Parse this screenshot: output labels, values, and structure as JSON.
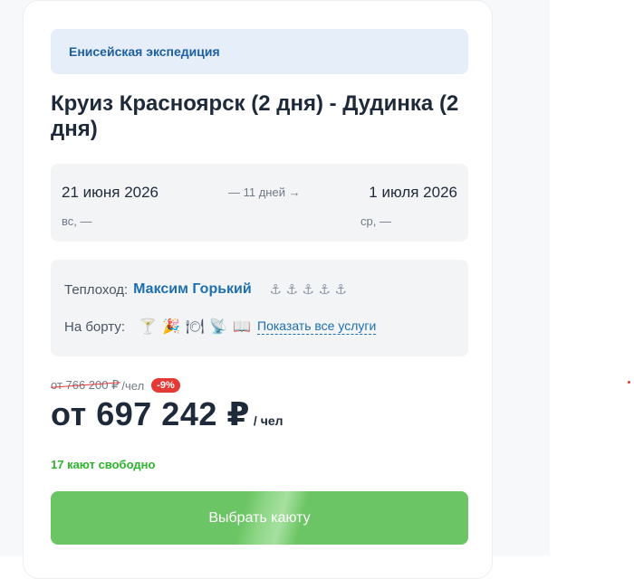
{
  "card": {
    "operator": "Енисейская экспедиция",
    "title": "Круиз Красноярск (2 дня) - Дудинка (2 дня)",
    "dates": {
      "start_date": "21 июня 2026",
      "start_day": "вс, —",
      "duration": "— 11 дней →",
      "end_date": "1 июля 2026",
      "end_day": "ср, —"
    },
    "ship": {
      "label": "Теплоход:",
      "name": "Максим Горький",
      "anchor_glyph": "⚓",
      "rating_anchors": 5
    },
    "onboard": {
      "label": "На борту:",
      "services": [
        {
          "icon": "bar-icon",
          "glyph": "🍸"
        },
        {
          "icon": "animation-icon",
          "glyph": "🎉"
        },
        {
          "icon": "restaurant-icon",
          "glyph": "🍽"
        },
        {
          "icon": "tv-icon",
          "glyph": "📡"
        },
        {
          "icon": "library-icon",
          "glyph": "📖"
        }
      ],
      "show_all": "Показать все услуги"
    },
    "price": {
      "old_price": "от 766 200 ₽",
      "old_per": "/чел",
      "discount": "-9%",
      "current": "от 697 242 ₽",
      "current_per": "/ чел"
    },
    "availability": "17 кают свободно",
    "cta": "Выбрать каюту"
  },
  "colors": {
    "accent_blue": "#1d6fb0",
    "cta_green": "#6cc564",
    "availability_green": "#2db42d",
    "discount_red": "#e53935"
  }
}
